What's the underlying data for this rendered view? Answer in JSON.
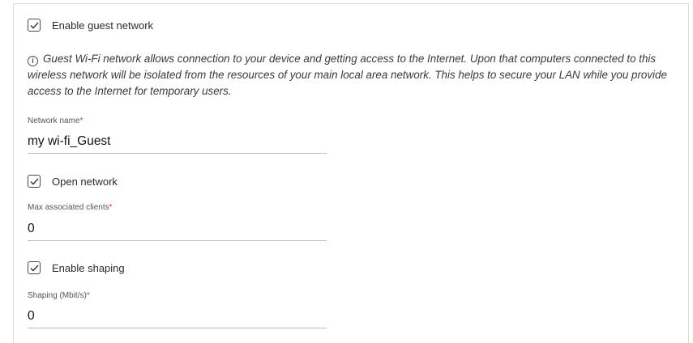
{
  "guest": {
    "enable_label": "Enable guest network",
    "enable_checked": true,
    "info_text": "Guest Wi-Fi network allows connection to your device and getting access to the Internet. Upon that computers connected to this wireless network will be isolated from the resources of your main local area network. This helps to secure your LAN while you provide access to the Internet for temporary users."
  },
  "network_name": {
    "label": "Network name",
    "required_mark": "*",
    "value": "my wi-fi_Guest"
  },
  "open_network": {
    "label": "Open network",
    "checked": true
  },
  "max_clients": {
    "label": "Max associated clients",
    "required_mark": "*",
    "value": "0"
  },
  "shaping": {
    "enable_label": "Enable shaping",
    "checked": true
  },
  "shaping_rate": {
    "label": "Shaping (Mbit/s)",
    "required_mark": "*",
    "value": "0"
  },
  "icons": {
    "checkbox": "check-icon",
    "info": "info-icon"
  }
}
